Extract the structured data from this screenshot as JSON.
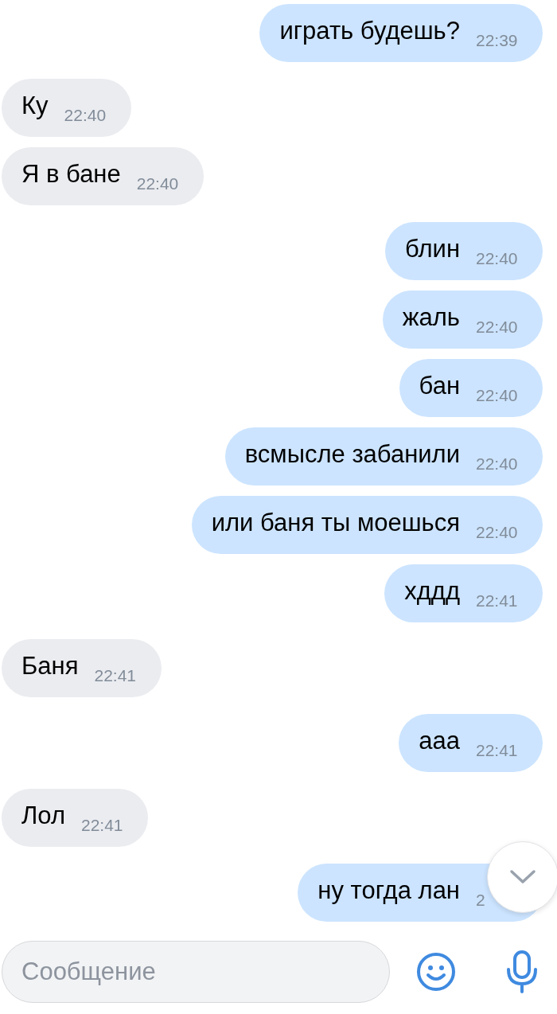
{
  "messages": [
    {
      "kind": "outgoing",
      "text": "играть будешь?",
      "time": "22:39"
    },
    {
      "kind": "incoming",
      "text": "Ку",
      "time": "22:40"
    },
    {
      "kind": "incoming",
      "text": "Я в бане",
      "time": "22:40"
    },
    {
      "kind": "outgoing",
      "text": "блин",
      "time": "22:40"
    },
    {
      "kind": "outgoing",
      "text": "жаль",
      "time": "22:40"
    },
    {
      "kind": "outgoing",
      "text": "бан",
      "time": "22:40"
    },
    {
      "kind": "outgoing",
      "text": "всмысле забанили",
      "time": "22:40"
    },
    {
      "kind": "outgoing",
      "text": "или баня ты моешься",
      "time": "22:40"
    },
    {
      "kind": "outgoing",
      "text": "хддд",
      "time": "22:41"
    },
    {
      "kind": "incoming",
      "text": "Баня",
      "time": "22:41"
    },
    {
      "kind": "outgoing",
      "text": "ааа",
      "time": "22:41"
    },
    {
      "kind": "incoming",
      "text": "Лол",
      "time": "22:41"
    },
    {
      "kind": "outgoing",
      "text": "ну тогда лан",
      "time": "2"
    }
  ],
  "composer": {
    "placeholder": "Сообщение"
  }
}
